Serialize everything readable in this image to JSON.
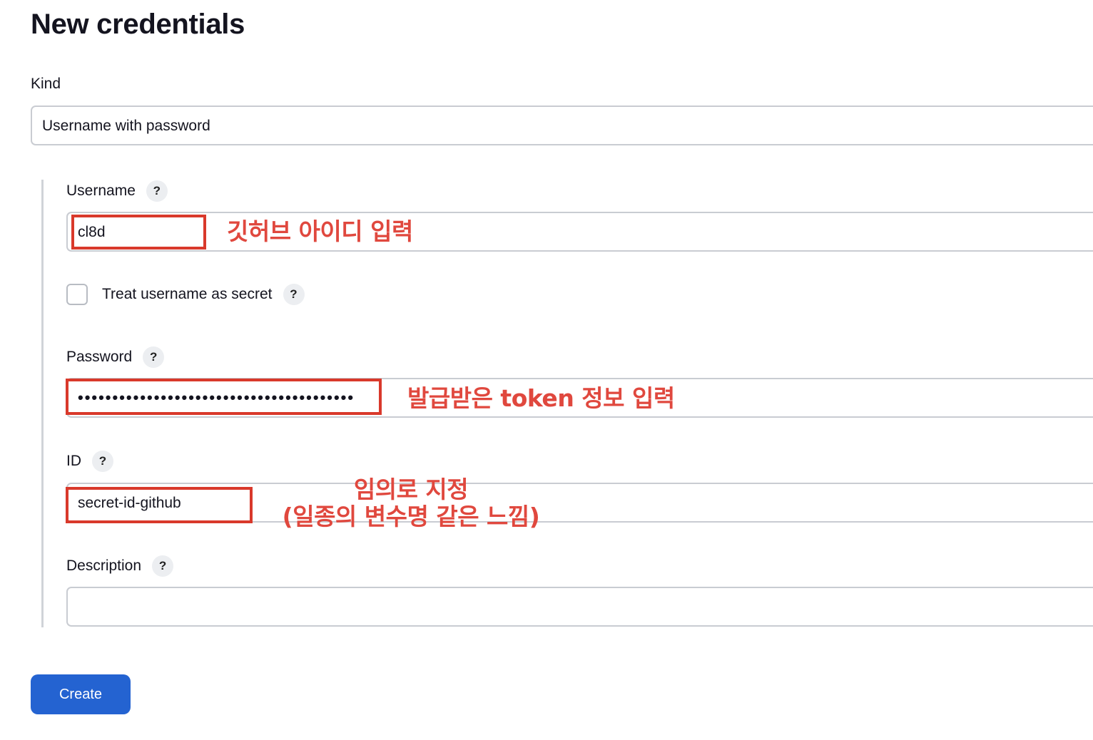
{
  "page": {
    "title": "New credentials"
  },
  "kind": {
    "label": "Kind",
    "selected": "Username with password"
  },
  "username": {
    "label": "Username",
    "help": "?",
    "value": "cl8d",
    "annotation": "깃허브 아이디 입력"
  },
  "treat_secret": {
    "label": "Treat username as secret",
    "help": "?",
    "checked": false
  },
  "password": {
    "label": "Password",
    "help": "?",
    "masked_value": "••••••••••••••••••••••••••••••••••••••••",
    "annotation": "발급받은 token 정보 입력"
  },
  "id_field": {
    "label": "ID",
    "help": "?",
    "value": "secret-id-github",
    "annotation_line1": "임의로 지정",
    "annotation_line2": "(일종의 변수명 같은 느낌)"
  },
  "description": {
    "label": "Description",
    "help": "?",
    "value": ""
  },
  "actions": {
    "create_label": "Create"
  },
  "colors": {
    "accent": "#2463d1",
    "annotation": "#e0483e",
    "highlight_border": "#d9392b"
  }
}
